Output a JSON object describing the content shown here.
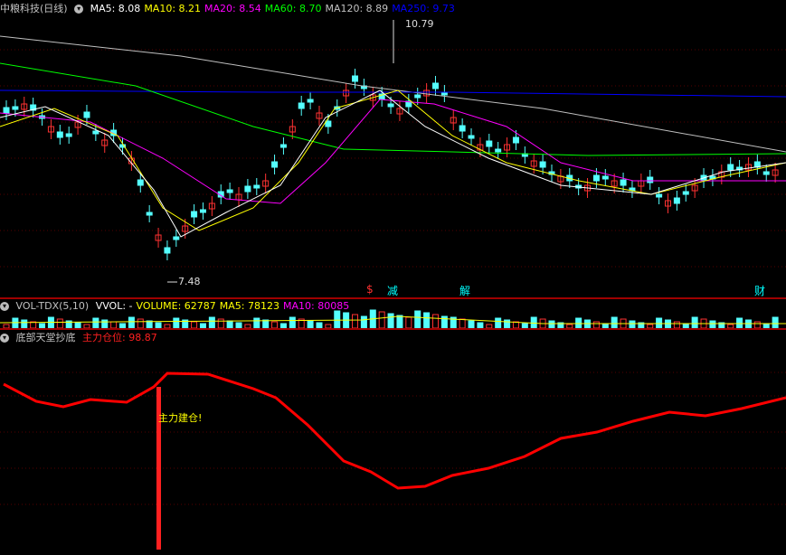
{
  "main": {
    "title": "中粮科技(日线)",
    "ma": [
      {
        "label": "MA5: 8.08",
        "color": "#ffffff"
      },
      {
        "label": "MA10: 8.21",
        "color": "#ffff00"
      },
      {
        "label": "MA20: 8.54",
        "color": "#ff00ff"
      },
      {
        "label": "MA60: 8.70",
        "color": "#00ff00"
      },
      {
        "label": "MA120: 8.89",
        "color": "#c0c0c0"
      },
      {
        "label": "MA250: 9.73",
        "color": "#0000ff"
      }
    ],
    "high_label": "10.79",
    "low_label": "7.48",
    "events": [
      {
        "text": "$",
        "color": "#ff3030"
      },
      {
        "text": "减",
        "color": "#00ffff"
      },
      {
        "text": "解",
        "color": "#00ffff"
      },
      {
        "text": "财",
        "color": "#00ffff"
      }
    ]
  },
  "volume": {
    "title": "VOL-TDX(5,10)",
    "items": [
      {
        "label": "VVOL: -",
        "color": "#ffffff"
      },
      {
        "label": "VOLUME: 62787",
        "color": "#ffff00"
      },
      {
        "label": "MA5: 78123",
        "color": "#ffff00"
      },
      {
        "label": "MA10: 80085",
        "color": "#ff00ff"
      }
    ]
  },
  "indicator": {
    "title": "底部天堂抄底",
    "value_label": "主力仓位: 98.87",
    "value_color": "#ff2020",
    "signal_text": "主力建仓!",
    "signal_color": "#ffff00"
  },
  "colors": {
    "up": "#ff3232",
    "down": "#54ffff",
    "line": "#ff0000"
  }
}
